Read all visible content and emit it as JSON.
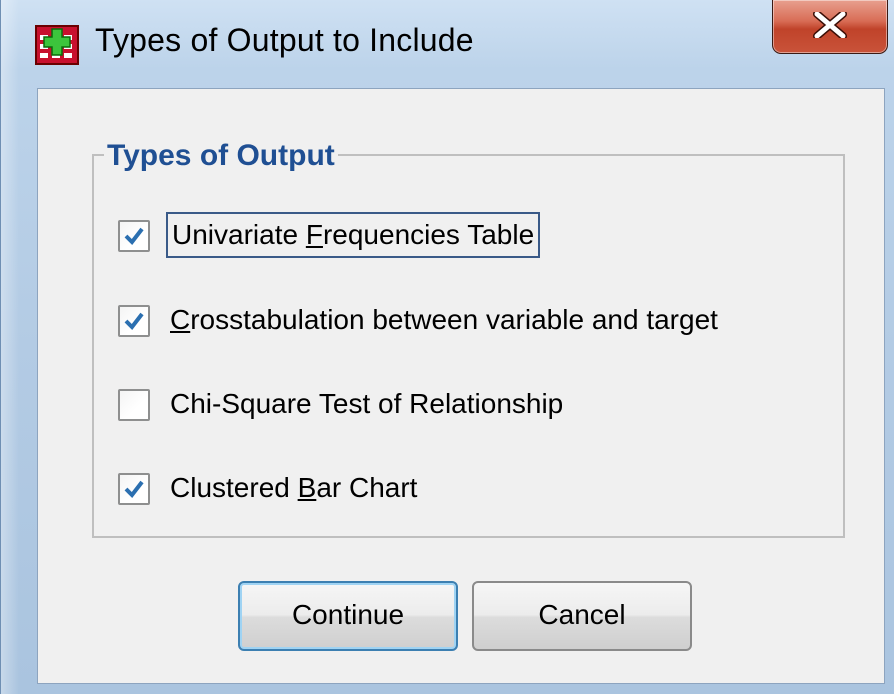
{
  "window": {
    "title": "Types of Output to Include",
    "app_icon": "spss-grid-plus-icon",
    "close_icon": "close-icon"
  },
  "group": {
    "title": "Types of Output"
  },
  "options": [
    {
      "label_pre": "Univariate ",
      "mnemonic": "F",
      "label_post": "requencies Table",
      "checked": true,
      "focused": true
    },
    {
      "label_pre": "",
      "mnemonic": "C",
      "label_post": "rosstabulation between variable and target",
      "checked": true,
      "focused": false
    },
    {
      "label_pre": "Chi-Square Test of Relationship",
      "mnemonic": "",
      "label_post": "",
      "checked": false,
      "focused": false
    },
    {
      "label_pre": "Clustered ",
      "mnemonic": "B",
      "label_post": "ar Chart",
      "checked": true,
      "focused": false
    }
  ],
  "buttons": {
    "continue_label": "Continue",
    "cancel_label": "Cancel"
  },
  "colors": {
    "group_title": "#1f4f93",
    "check": "#2b6fb0",
    "close_button": "#c9533a"
  }
}
